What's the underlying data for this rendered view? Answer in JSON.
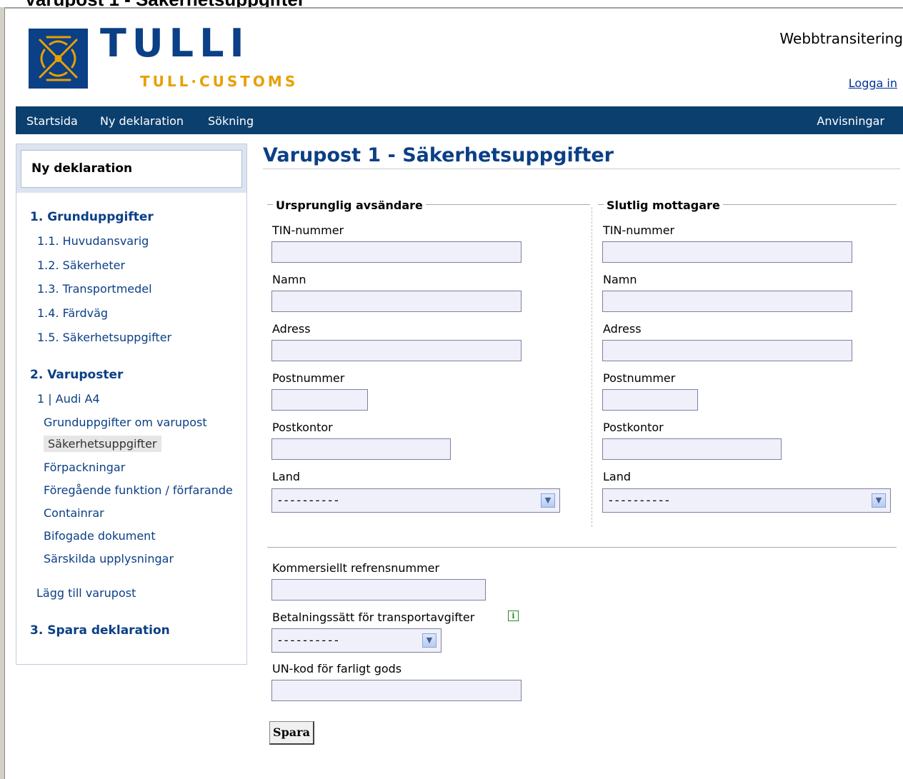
{
  "header": {
    "cropped_title": "Varupost 1 - Säkerhetsuppgifter",
    "logo_title": "TULLI",
    "logo_subtitle": "TULL·CUSTOMS",
    "app_name": "Webbtransitering",
    "login": "Logga in"
  },
  "nav": {
    "items": [
      "Startsida",
      "Ny deklaration",
      "Sökning"
    ],
    "help": "Anvisningar"
  },
  "sidebar": {
    "title": "Ny deklaration",
    "section1": "1. Grunduppgifter",
    "section1_items": [
      "1.1. Huvudansvarig",
      "1.2. Säkerheter",
      "1.3. Transportmedel",
      "1.4. Färdväg",
      "1.5. Säkerhetsuppgifter"
    ],
    "section2": "2. Varuposter",
    "item_entry": "1 | Audi A4",
    "item_subitems": [
      "Grunduppgifter om varupost",
      "Säkerhetsuppgifter",
      "Förpackningar",
      "Föregående funktion / förfarande",
      "Containrar",
      "Bifogade dokument",
      "Särskilda upplysningar"
    ],
    "add_item": "Lägg till varupost",
    "section3": "3. Spara deklaration"
  },
  "main": {
    "title": "Varupost 1 - Säkerhetsuppgifter",
    "consignor": {
      "legend": "Ursprunglig avsändare",
      "tin_label": "TIN-nummer",
      "tin_value": "",
      "name_label": "Namn",
      "name_value": "",
      "address_label": "Adress",
      "address_value": "",
      "postcode_label": "Postnummer",
      "postcode_value": "",
      "city_label": "Postkontor",
      "city_value": "",
      "country_label": "Land",
      "country_value": "----------"
    },
    "consignee": {
      "legend": "Slutlig mottagare",
      "tin_label": "TIN-nummer",
      "tin_value": "",
      "name_label": "Namn",
      "name_value": "",
      "address_label": "Adress",
      "address_value": "",
      "postcode_label": "Postnummer",
      "postcode_value": "",
      "city_label": "Postkontor",
      "city_value": "",
      "country_label": "Land",
      "country_value": "----------"
    },
    "commercial_ref_label": "Kommersiellt refrensnummer",
    "commercial_ref_value": "",
    "payment_label": "Betalningssätt för transportavgifter",
    "payment_value": "----------",
    "un_code_label": "UN-kod för farligt gods",
    "un_code_value": "",
    "save_button": "Spara"
  },
  "colors": {
    "brand_blue": "#0b3f86",
    "navbar": "#0b3f6e",
    "brand_orange": "#e8a000",
    "input_bg": "#f0f0fa"
  },
  "icons": [
    "customs-emblem-icon",
    "chevron-down-icon",
    "info-icon"
  ]
}
